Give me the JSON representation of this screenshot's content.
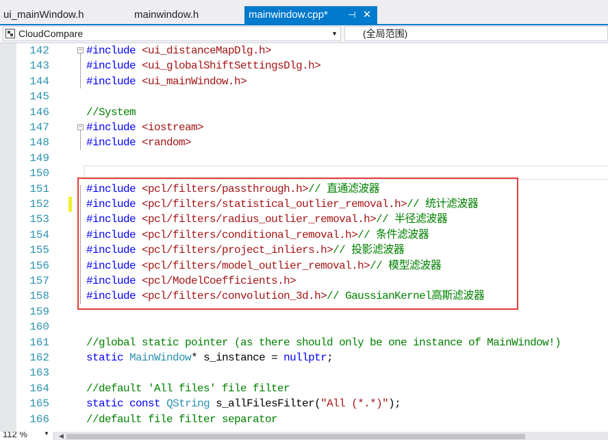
{
  "tabs": {
    "items": [
      {
        "label": "ui_mainWindow.h"
      },
      {
        "label": "mainwindow.h"
      }
    ],
    "active": {
      "label": "mainwindow.cpp*",
      "pin_icon": "pin-icon",
      "close_icon": "close-icon"
    }
  },
  "navbar": {
    "project": "CloudCompare",
    "scope": "(全局范围)"
  },
  "editor": {
    "lines": [
      {
        "num": "142",
        "tokens": [
          {
            "t": "#include",
            "c": "pp"
          },
          {
            "t": " "
          },
          {
            "t": "<ui_distanceMapDlg.h>",
            "c": "str"
          }
        ]
      },
      {
        "num": "143",
        "tokens": [
          {
            "t": "#include",
            "c": "pp"
          },
          {
            "t": " "
          },
          {
            "t": "<ui_globalShiftSettingsDlg.h>",
            "c": "str"
          }
        ]
      },
      {
        "num": "144",
        "tokens": [
          {
            "t": "#include",
            "c": "pp"
          },
          {
            "t": " "
          },
          {
            "t": "<ui_mainWindow.h>",
            "c": "str"
          }
        ]
      },
      {
        "num": "145",
        "tokens": []
      },
      {
        "num": "146",
        "tokens": [
          {
            "t": "//System",
            "c": "cmt"
          }
        ]
      },
      {
        "num": "147",
        "tokens": [
          {
            "t": "#include",
            "c": "pp"
          },
          {
            "t": " "
          },
          {
            "t": "<iostream>",
            "c": "str"
          }
        ]
      },
      {
        "num": "148",
        "tokens": [
          {
            "t": "#include",
            "c": "pp"
          },
          {
            "t": " "
          },
          {
            "t": "<random>",
            "c": "str"
          }
        ]
      },
      {
        "num": "149",
        "tokens": []
      },
      {
        "num": "150",
        "tokens": []
      },
      {
        "num": "151",
        "tokens": [
          {
            "t": "#include",
            "c": "pp"
          },
          {
            "t": " "
          },
          {
            "t": "<pcl/filters/passthrough.h>",
            "c": "str"
          },
          {
            "t": "// 直通滤波器",
            "c": "cmt"
          }
        ]
      },
      {
        "num": "152",
        "tokens": [
          {
            "t": "#include",
            "c": "pp"
          },
          {
            "t": " "
          },
          {
            "t": "<pcl/filters/statistical_outlier_removal.h>",
            "c": "str"
          },
          {
            "t": "// 统计滤波器",
            "c": "cmt"
          }
        ]
      },
      {
        "num": "153",
        "tokens": [
          {
            "t": "#include",
            "c": "pp"
          },
          {
            "t": " "
          },
          {
            "t": "<pcl/filters/radius_outlier_removal.h>",
            "c": "str"
          },
          {
            "t": "// 半径滤波器",
            "c": "cmt"
          }
        ]
      },
      {
        "num": "154",
        "tokens": [
          {
            "t": "#include",
            "c": "pp"
          },
          {
            "t": " "
          },
          {
            "t": "<pcl/filters/conditional_removal.h>",
            "c": "str"
          },
          {
            "t": "// 条件滤波器",
            "c": "cmt"
          }
        ]
      },
      {
        "num": "155",
        "tokens": [
          {
            "t": "#include",
            "c": "pp"
          },
          {
            "t": " "
          },
          {
            "t": "<pcl/filters/project_inliers.h>",
            "c": "str"
          },
          {
            "t": "// 投影滤波器",
            "c": "cmt"
          }
        ]
      },
      {
        "num": "156",
        "tokens": [
          {
            "t": "#include",
            "c": "pp"
          },
          {
            "t": " "
          },
          {
            "t": "<pcl/filters/model_outlier_removal.h>",
            "c": "str"
          },
          {
            "t": "// 模型滤波器",
            "c": "cmt"
          }
        ]
      },
      {
        "num": "157",
        "tokens": [
          {
            "t": "#include",
            "c": "pp"
          },
          {
            "t": " "
          },
          {
            "t": "<pcl/ModelCoefficients.h>",
            "c": "str"
          }
        ]
      },
      {
        "num": "158",
        "tokens": [
          {
            "t": "#include",
            "c": "pp"
          },
          {
            "t": " "
          },
          {
            "t": "<pcl/filters/convolution_3d.h>",
            "c": "str"
          },
          {
            "t": "// GaussianKernel高斯滤波器",
            "c": "cmt"
          }
        ]
      },
      {
        "num": "159",
        "tokens": []
      },
      {
        "num": "160",
        "tokens": []
      },
      {
        "num": "161",
        "tokens": [
          {
            "t": "//global static pointer (as there should only be one instance of MainWindow!)",
            "c": "cmt"
          }
        ]
      },
      {
        "num": "162",
        "tokens": [
          {
            "t": "static",
            "c": "kw"
          },
          {
            "t": " "
          },
          {
            "t": "MainWindow",
            "c": "type"
          },
          {
            "t": "* s_instance = "
          },
          {
            "t": "nullptr",
            "c": "kw"
          },
          {
            "t": ";"
          }
        ]
      },
      {
        "num": "163",
        "tokens": []
      },
      {
        "num": "164",
        "tokens": [
          {
            "t": "//default 'All files' file filter",
            "c": "cmt"
          }
        ]
      },
      {
        "num": "165",
        "tokens": [
          {
            "t": "static",
            "c": "kw"
          },
          {
            "t": " "
          },
          {
            "t": "const",
            "c": "kw"
          },
          {
            "t": " "
          },
          {
            "t": "QString",
            "c": "type"
          },
          {
            "t": " s_allFilesFilter("
          },
          {
            "t": "\"All (*.*)\"",
            "c": "str"
          },
          {
            "t": ");"
          }
        ]
      },
      {
        "num": "166",
        "tokens": [
          {
            "t": "//default file filter separator",
            "c": "cmt"
          }
        ]
      }
    ]
  },
  "bottom": {
    "zoom": "112 %"
  },
  "colors": {
    "accent": "#007acc",
    "highlight_box": "#e53935",
    "line_number": "#2b91af",
    "keyword": "#0000ff",
    "string": "#a31515",
    "comment": "#008000"
  }
}
